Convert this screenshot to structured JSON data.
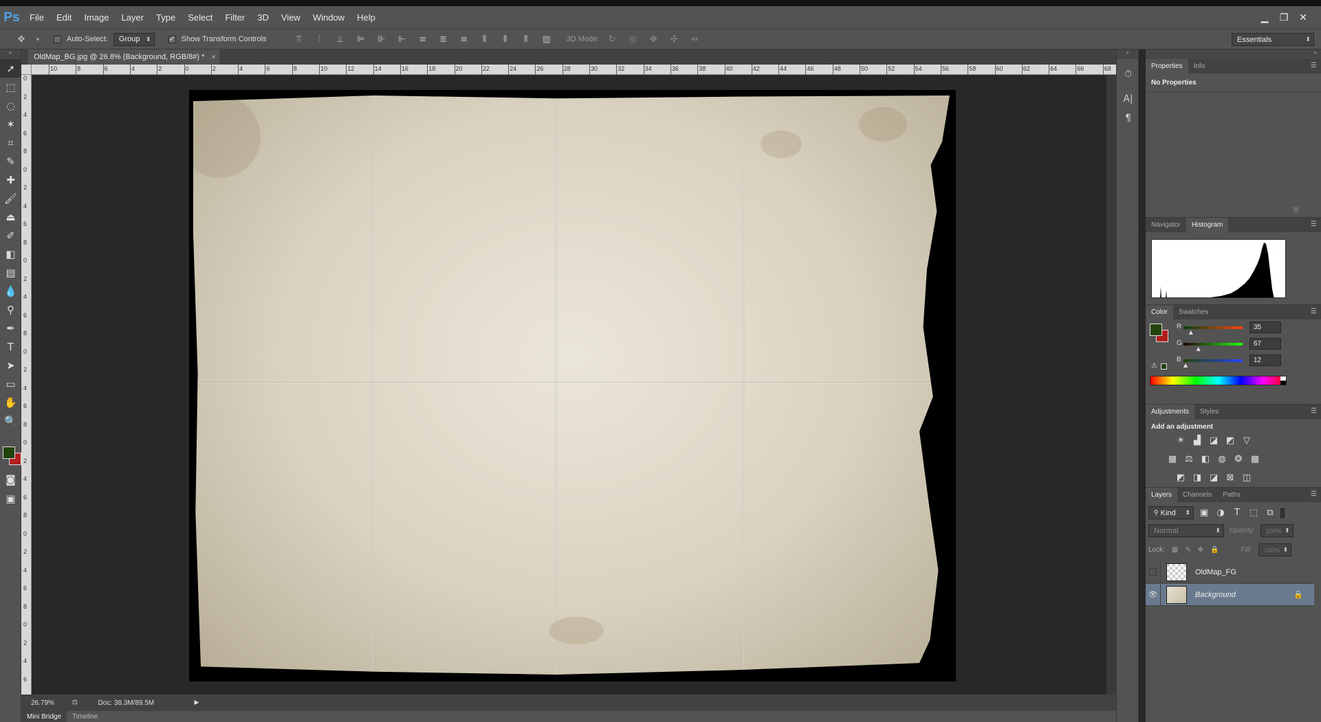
{
  "app": {
    "logo": "Ps"
  },
  "menu": [
    "File",
    "Edit",
    "Image",
    "Layer",
    "Type",
    "Select",
    "Filter",
    "3D",
    "View",
    "Window",
    "Help"
  ],
  "window_controls": {
    "minimize": "▁",
    "restore": "❐",
    "close": "✕"
  },
  "options": {
    "auto_select_label": "Auto-Select:",
    "auto_select_checked": false,
    "auto_select_value": "Group",
    "show_transform_label": "Show Transform Controls",
    "show_transform_checked": true,
    "mode_3d_label": "3D Mode:",
    "workspace": "Essentials"
  },
  "document": {
    "tab_title": "OldMap_BG.jpg @ 26.8% (Background, RGB/8#) *",
    "close_label": "×"
  },
  "rulers": {
    "horizontal": [
      "10",
      "8",
      "6",
      "4",
      "2",
      "0",
      "2",
      "4",
      "6",
      "8",
      "10",
      "12",
      "14",
      "16",
      "18",
      "20",
      "22",
      "24",
      "26",
      "28",
      "30",
      "32",
      "34",
      "36",
      "38",
      "40",
      "42",
      "44",
      "46",
      "48",
      "50",
      "52",
      "54",
      "56",
      "58",
      "60",
      "62",
      "64",
      "66",
      "68"
    ],
    "vertical": [
      "0",
      "2",
      "4",
      "6",
      "8",
      "0",
      "2",
      "4",
      "6",
      "8",
      "0",
      "2",
      "4",
      "6",
      "8",
      "0",
      "2",
      "4",
      "6",
      "8",
      "0",
      "2",
      "4",
      "6",
      "8",
      "0",
      "2",
      "4",
      "6",
      "8",
      "0",
      "2",
      "4",
      "6"
    ]
  },
  "status": {
    "zoom": "26.79%",
    "doc_size": "Doc: 38.3M/89.5M",
    "arrow": "▶"
  },
  "bottom_tabs": [
    "Mini Bridge",
    "Timeline"
  ],
  "panels": {
    "properties": {
      "tabs": [
        "Properties",
        "Info"
      ],
      "active": 0,
      "body_text": "No Properties"
    },
    "navigator": {
      "tabs": [
        "Navigator",
        "Histogram"
      ],
      "active": 1,
      "warning": "⚠"
    },
    "color": {
      "tabs": [
        "Color",
        "Swatches"
      ],
      "active": 0,
      "fg": "#23430c",
      "bg": "#b21e1e",
      "channels": [
        {
          "label": "R",
          "value": "35",
          "fraction": 0.137
        },
        {
          "label": "G",
          "value": "67",
          "fraction": 0.263
        },
        {
          "label": "B",
          "value": "12",
          "fraction": 0.047
        }
      ]
    },
    "adjustments": {
      "tabs": [
        "Adjustments",
        "Styles"
      ],
      "active": 0,
      "heading": "Add an adjustment"
    },
    "layers": {
      "tabs": [
        "Layers",
        "Channels",
        "Paths"
      ],
      "active": 0,
      "filter_kind": "Kind",
      "blend_mode": "Normal",
      "opacity_label": "Opacity:",
      "opacity_value": "100%",
      "lock_label": "Lock:",
      "fill_label": "Fill:",
      "fill_value": "100%",
      "items": [
        {
          "name": "OldMap_FG",
          "visible": false,
          "locked": false,
          "selected": false
        },
        {
          "name": "Background",
          "visible": true,
          "locked": true,
          "selected": true
        }
      ]
    }
  }
}
